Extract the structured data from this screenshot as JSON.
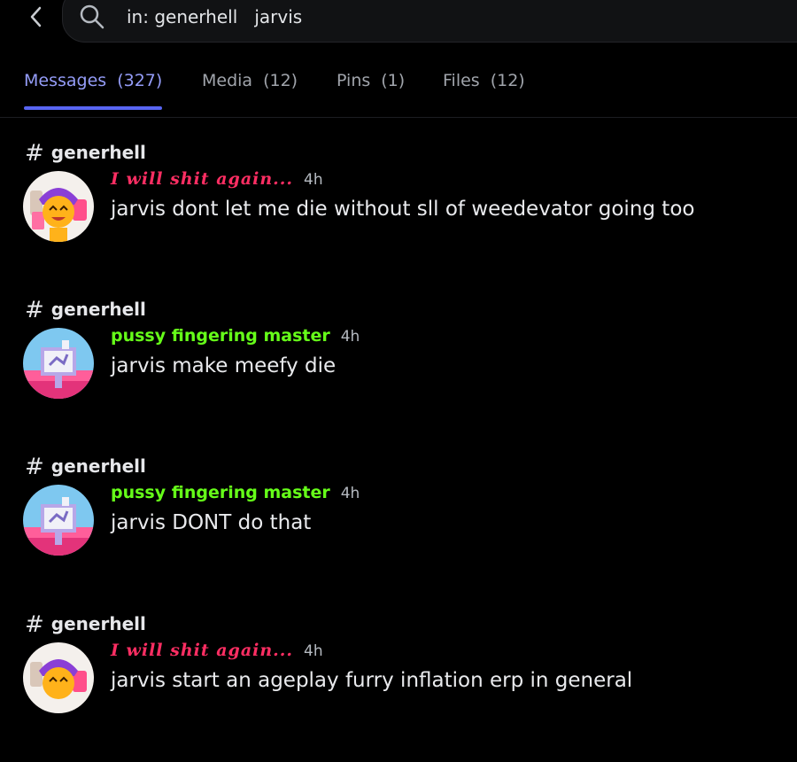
{
  "header": {
    "back_icon": "chevron-left-icon",
    "search_icon": "search-icon",
    "query": "in: generhell   jarvis"
  },
  "tabs": [
    {
      "label": "Messages",
      "count": "(327)",
      "active": true
    },
    {
      "label": "Media",
      "count": "(12)",
      "active": false
    },
    {
      "label": "Pins",
      "count": "(1)",
      "active": false
    },
    {
      "label": "Files",
      "count": "(12)",
      "active": false
    }
  ],
  "colors": {
    "background": "#000000",
    "active_tab": "#949cf7",
    "tab_indicator": "#5865f2",
    "author_pink": "#ff2e63",
    "author_green": "#66ff19"
  },
  "results": [
    {
      "channel": "generhell",
      "author": "I will shit again...",
      "time": "4h",
      "content": "jarvis dont let me die without sll of weedevator going too",
      "avatar": "purple-hair-character-avatar"
    },
    {
      "channel": "generhell",
      "author": "pussy fingering master",
      "time": "4h",
      "content": "jarvis make meefy die",
      "avatar": "pixel-tv-character-avatar"
    },
    {
      "channel": "generhell",
      "author": "pussy fingering master",
      "time": "4h",
      "content": "jarvis DONT do that",
      "avatar": "pixel-tv-character-avatar"
    },
    {
      "channel": "generhell",
      "author": "I will shit again...",
      "time": "4h",
      "content": "jarvis start an ageplay furry inflation erp in general",
      "avatar": "purple-hair-character-avatar"
    }
  ]
}
